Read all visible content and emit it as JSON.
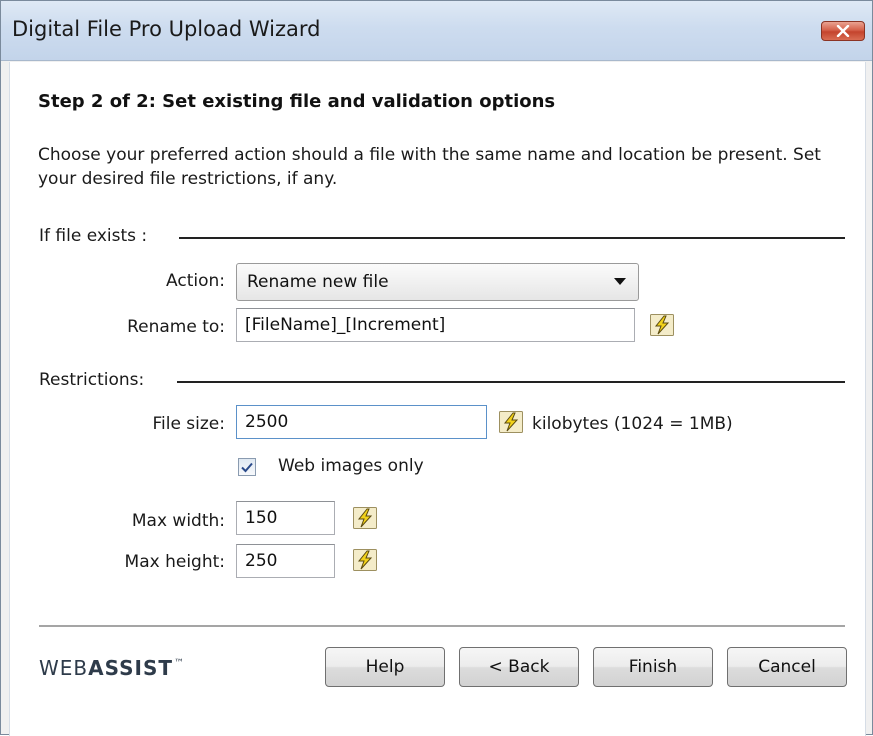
{
  "window": {
    "title": "Digital File Pro Upload Wizard"
  },
  "step": {
    "heading": "Step 2 of 2: Set existing file and validation options",
    "description": "Choose your preferred action should a file with the same name and location be present. Set your desired file restrictions, if any."
  },
  "if_file_exists": {
    "group_label": "If file exists :",
    "action_label": "Action:",
    "action_value": "Rename new file",
    "rename_label": "Rename to:",
    "rename_value": "[FileName]_[Increment]"
  },
  "restrictions": {
    "group_label": "Restrictions:",
    "file_size_label": "File size:",
    "file_size_value": "2500",
    "file_size_unit": "kilobytes (1024 = 1MB)",
    "web_images_only_label": "Web images only",
    "web_images_only_checked": true,
    "max_width_label": "Max width:",
    "max_width_value": "150",
    "max_height_label": "Max height:",
    "max_height_value": "250"
  },
  "footer": {
    "logo_web": "WEB",
    "logo_assist": "ASSIST",
    "logo_tm": "™",
    "help_label": "Help",
    "back_label": "< Back",
    "finish_label": "Finish",
    "cancel_label": "Cancel"
  },
  "icons": {
    "close": "close-icon",
    "dropdown": "chevron-down-icon",
    "dynamic_value": "lightning-bolt-icon",
    "check": "checkmark-icon"
  },
  "colors": {
    "title_bar": "#cddcef",
    "close_button": "#d5614a",
    "focus_border": "#5b91c9"
  }
}
